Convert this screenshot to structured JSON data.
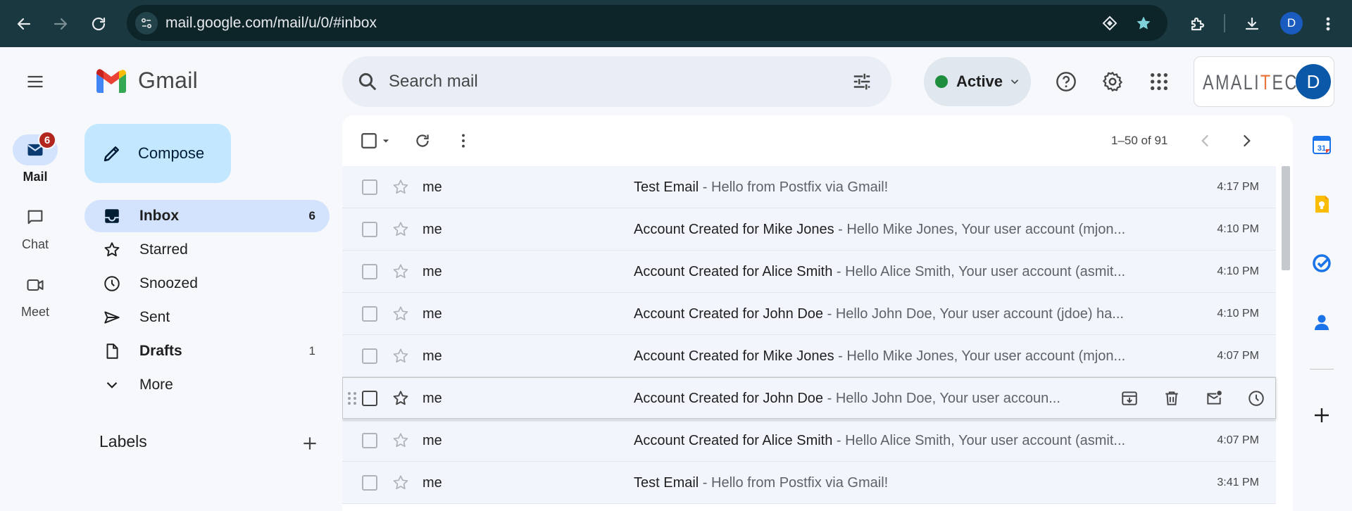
{
  "browser": {
    "url": "mail.google.com/mail/u/0/#inbox",
    "profile_initial": "D"
  },
  "rail": {
    "items": [
      {
        "label": "Mail",
        "badge": "6"
      },
      {
        "label": "Chat"
      },
      {
        "label": "Meet"
      }
    ]
  },
  "app": {
    "name": "Gmail"
  },
  "compose": {
    "label": "Compose"
  },
  "nav": {
    "items": [
      {
        "label": "Inbox",
        "count": "6"
      },
      {
        "label": "Starred"
      },
      {
        "label": "Snoozed"
      },
      {
        "label": "Sent"
      },
      {
        "label": "Drafts",
        "count": "1"
      },
      {
        "label": "More"
      }
    ],
    "labels_heading": "Labels"
  },
  "search": {
    "placeholder": "Search mail"
  },
  "status": {
    "label": "Active",
    "color": "#1e8e3e"
  },
  "account": {
    "org_prefix": "AMALI",
    "org_accent": "T",
    "org_suffix": "ECH",
    "initial": "D"
  },
  "toolbar": {
    "pagination": "1–50 of 91"
  },
  "emails": [
    {
      "sender": "me",
      "subject": "Test Email",
      "snippet": " - Hello from Postfix via Gmail!",
      "time": "4:17 PM"
    },
    {
      "sender": "me",
      "subject": "Account Created for Mike Jones",
      "snippet": " - Hello Mike Jones, Your user account (mjon...",
      "time": "4:10 PM"
    },
    {
      "sender": "me",
      "subject": "Account Created for Alice Smith",
      "snippet": " - Hello Alice Smith, Your user account (asmit...",
      "time": "4:10 PM"
    },
    {
      "sender": "me",
      "subject": "Account Created for John Doe",
      "snippet": " - Hello John Doe, Your user account (jdoe) ha...",
      "time": "4:10 PM"
    },
    {
      "sender": "me",
      "subject": "Account Created for Mike Jones",
      "snippet": " - Hello Mike Jones, Your user account (mjon...",
      "time": "4:07 PM"
    },
    {
      "sender": "me",
      "subject": "Account Created for John Doe",
      "snippet": " - Hello John Doe, Your user accoun...",
      "time": ""
    },
    {
      "sender": "me",
      "subject": "Account Created for Alice Smith",
      "snippet": " - Hello Alice Smith, Your user account (asmit...",
      "time": "4:07 PM"
    },
    {
      "sender": "me",
      "subject": "Test Email",
      "snippet": " - Hello from Postfix via Gmail!",
      "time": "3:41 PM"
    }
  ],
  "side_panel": {
    "calendar_day": "31"
  }
}
